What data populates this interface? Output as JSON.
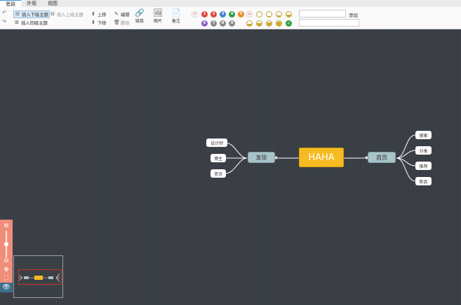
{
  "tabs": [
    {
      "label": "思路"
    },
    {
      "label": "外观"
    },
    {
      "label": "视图"
    }
  ],
  "toolbar": {
    "insert_child": "插入下级主题",
    "insert_parent": "插入上级主题",
    "insert_sibling": "插入同级主题",
    "move_up": "上移",
    "move_down": "下移",
    "edit": "编辑",
    "delete": "删除",
    "link": "链接",
    "image": "图片",
    "note": "备注",
    "add": "添加"
  },
  "priorities": [
    "1",
    "2",
    "3",
    "4",
    "5",
    "6",
    "7",
    "8",
    "9"
  ],
  "priority_colors": [
    "#e3453a",
    "#e3453a",
    "#3d7fd0",
    "#2e9e48",
    "#e88b1d",
    "#8b62c7",
    "#8a8a8a",
    "#8a8a8a",
    "#8a8a8a"
  ],
  "progress_levels": [
    0,
    0.125,
    0.25,
    0.375,
    0.5,
    0.625,
    0.75,
    0.875,
    1
  ],
  "mindmap": {
    "root": "HAHA",
    "left": {
      "label": "发现",
      "children": [
        "设计师",
        "博主",
        "资讯"
      ]
    },
    "right": {
      "label": "首页",
      "children": [
        "搜索",
        "分类",
        "推荐",
        "新品"
      ]
    }
  },
  "colors": {
    "root": "#f6bb21",
    "main": "#a8c4c9",
    "canvas": "#393e44",
    "sidebar": "#f08d7b"
  }
}
